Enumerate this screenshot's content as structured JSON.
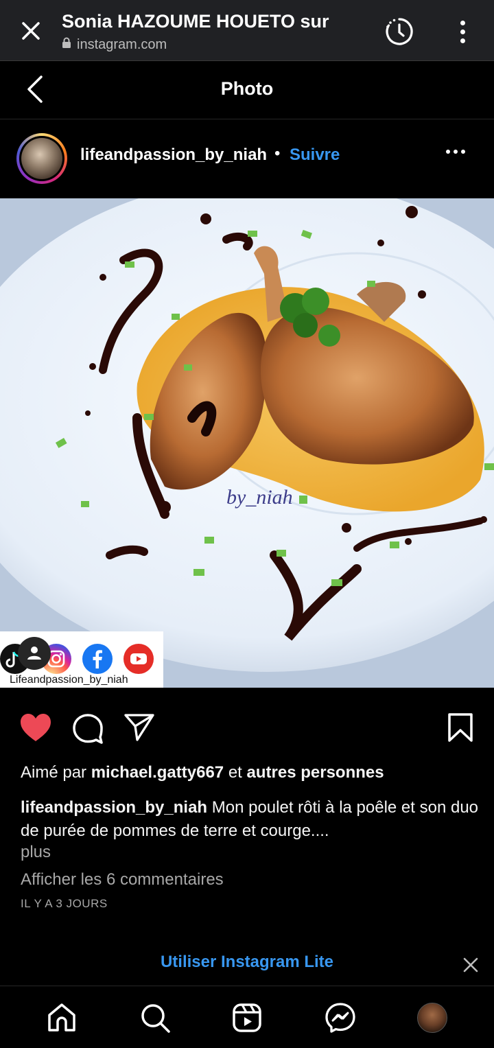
{
  "browser": {
    "title": "Sonia HAZOUME HOUETO sur",
    "url": "instagram.com"
  },
  "header": {
    "title": "Photo"
  },
  "post": {
    "username": "lifeandpassion_by_niah",
    "separator": "•",
    "follow_label": "Suivre",
    "watermark": "by_niah",
    "social_strip_text": "Lifeandpassion_by_niah",
    "liked": true,
    "likes_prefix": "Aimé par",
    "likes_user": "michael.gatty667",
    "likes_middle": "et",
    "likes_suffix": "autres personnes",
    "caption_user": "lifeandpassion_by_niah",
    "caption_text": "Mon poulet rôti à la poêle et son duo de purée de pommes de terre et courge....",
    "more_label": "plus",
    "comments_link": "Afficher les 6 commentaires",
    "timestamp": "IL Y A 3 JOURS"
  },
  "banner": {
    "label": "Utiliser Instagram Lite"
  },
  "colors": {
    "accent": "#3897f0",
    "like": "#ed4956",
    "background": "#000000"
  },
  "icons": {
    "close": "close-icon",
    "history": "history-icon",
    "menu": "more-vert-icon",
    "back": "chevron-left-icon",
    "like": "heart-icon",
    "comment": "comment-icon",
    "share": "paper-plane-icon",
    "save": "bookmark-icon",
    "home": "home-icon",
    "search": "search-icon",
    "reels": "reels-icon",
    "messenger": "messenger-icon"
  }
}
